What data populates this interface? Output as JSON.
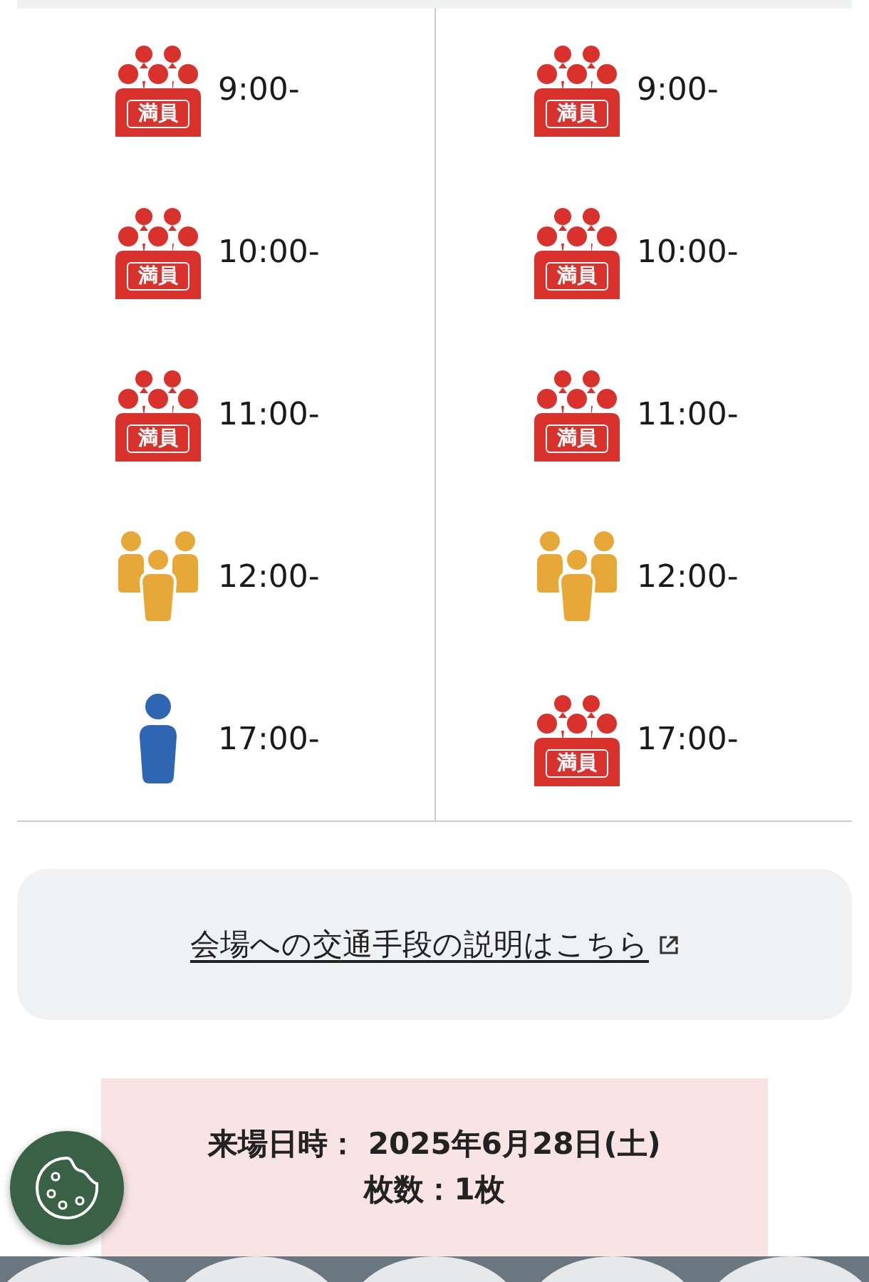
{
  "slot_columns": [
    {
      "slots": [
        {
          "time": "9:00-",
          "kind": "full",
          "badge": "満員"
        },
        {
          "time": "10:00-",
          "kind": "full",
          "badge": "満員"
        },
        {
          "time": "11:00-",
          "kind": "full",
          "badge": "満員"
        },
        {
          "time": "12:00-",
          "kind": "crowded"
        },
        {
          "time": "17:00-",
          "kind": "available"
        }
      ]
    },
    {
      "slots": [
        {
          "time": "9:00-",
          "kind": "full",
          "badge": "満員"
        },
        {
          "time": "10:00-",
          "kind": "full",
          "badge": "満員"
        },
        {
          "time": "11:00-",
          "kind": "full",
          "badge": "満員"
        },
        {
          "time": "12:00-",
          "kind": "crowded"
        },
        {
          "time": "17:00-",
          "kind": "full",
          "badge": "満員"
        }
      ]
    }
  ],
  "access_link": {
    "label": "会場への交通手段の説明はこちら"
  },
  "summary": {
    "lines": [
      "来場日時： 2025年6月28日(土)",
      "枚数：1枚"
    ]
  }
}
